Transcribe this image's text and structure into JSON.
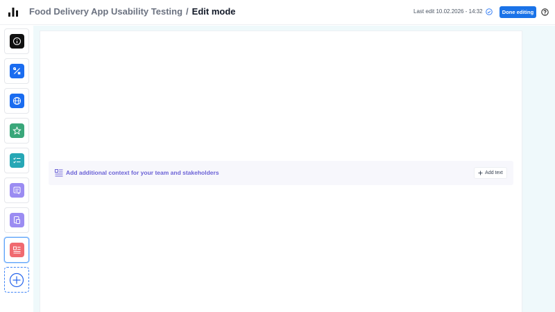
{
  "header": {
    "project_title": "Food Delivery App Usability Testing",
    "separator": "/",
    "mode": "Edit mode",
    "last_edit": "Last edit 10.02.2026 - 14:32",
    "done_button": "Done editing"
  },
  "sidebar": {
    "items": [
      {
        "icon": "info-icon",
        "color": "#111111"
      },
      {
        "icon": "tools-icon",
        "color": "#1a6cf0"
      },
      {
        "icon": "globe-icon",
        "color": "#1a6cf0"
      },
      {
        "icon": "star-icon",
        "color": "#3aa77a"
      },
      {
        "icon": "checklist-icon",
        "color": "#27a7b5"
      },
      {
        "icon": "card-icon",
        "color": "#9b8cf2"
      },
      {
        "icon": "document-icon",
        "color": "#9b8cf2"
      },
      {
        "icon": "text-block-icon",
        "color": "#f06a70"
      }
    ],
    "add_icon": "plus-circle-icon"
  },
  "context": {
    "prompt": "Add additional context for your team and stakeholders",
    "add_text_label": "Add text",
    "accent": "#6b62d6"
  },
  "colors": {
    "primary_button": "#1a73e8",
    "canvas_background": "#eff9fb"
  }
}
